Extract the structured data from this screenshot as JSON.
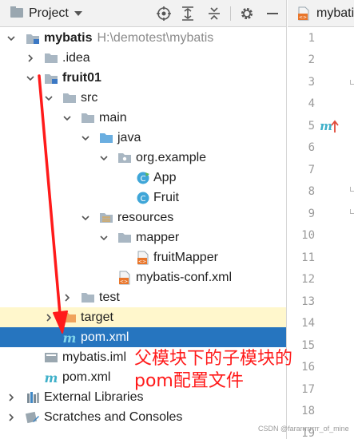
{
  "toolbar": {
    "title": "Project",
    "icons": [
      "chevron-down-icon",
      "target-icon",
      "expand-all-icon",
      "collapse-all-icon",
      "gear-icon",
      "minimize-icon"
    ]
  },
  "tree": [
    {
      "label": "mybatis",
      "path": "H:\\demotest\\mybatis",
      "icon": "module-folder-icon",
      "state": "expanded"
    },
    {
      "label": ".idea",
      "icon": "folder-icon",
      "state": "collapsed"
    },
    {
      "label": "fruit01",
      "icon": "module-folder-icon",
      "state": "expanded"
    },
    {
      "label": "src",
      "icon": "folder-icon",
      "state": "expanded"
    },
    {
      "label": "main",
      "icon": "folder-icon",
      "state": "expanded"
    },
    {
      "label": "java",
      "icon": "source-folder-icon",
      "state": "expanded"
    },
    {
      "label": "org.example",
      "icon": "package-icon",
      "state": "expanded"
    },
    {
      "label": "App",
      "icon": "class-icon",
      "state": "leaf"
    },
    {
      "label": "Fruit",
      "icon": "class-icon",
      "state": "leaf"
    },
    {
      "label": "resources",
      "icon": "resources-folder-icon",
      "state": "expanded"
    },
    {
      "label": "mapper",
      "icon": "folder-icon",
      "state": "expanded"
    },
    {
      "label": "fruitMapper",
      "icon": "xml-file-icon",
      "state": "leaf"
    },
    {
      "label": "mybatis-conf.xml",
      "icon": "xml-file-icon",
      "state": "leaf"
    },
    {
      "label": "test",
      "icon": "folder-icon",
      "state": "collapsed"
    },
    {
      "label": "target",
      "icon": "excluded-folder-icon",
      "state": "collapsed"
    },
    {
      "label": "pom.xml",
      "icon": "maven-icon",
      "state": "selected"
    },
    {
      "label": "mybatis.iml",
      "icon": "iml-file-icon",
      "state": "leaf"
    },
    {
      "label": "pom.xml",
      "icon": "maven-icon",
      "state": "leaf"
    },
    {
      "label": "External Libraries",
      "icon": "libraries-icon",
      "state": "collapsed"
    },
    {
      "label": "Scratches and Consoles",
      "icon": "scratches-icon",
      "state": "collapsed"
    }
  ],
  "editor": {
    "tab_label": "mybati",
    "line_numbers": [
      "1",
      "2",
      "3",
      "4",
      "5",
      "6",
      "7",
      "8",
      "9",
      "10",
      "11",
      "12",
      "13",
      "14",
      "15",
      "16",
      "17",
      "18",
      "19"
    ]
  },
  "annotation": {
    "line1": "父模块下的子模块的",
    "line2": "pom配置文件"
  },
  "watermark": "CSDN @fararrrrrrrr_of_mine",
  "colors": {
    "selection": "#2675bf",
    "highlight_row": "#fff7cc",
    "annotation": "#ff1a1a",
    "folder_blue": "#6aaee0",
    "folder_gray": "#a9b7c3",
    "target_orange": "#f0a35c",
    "maven_teal": "#3fb0c9"
  }
}
